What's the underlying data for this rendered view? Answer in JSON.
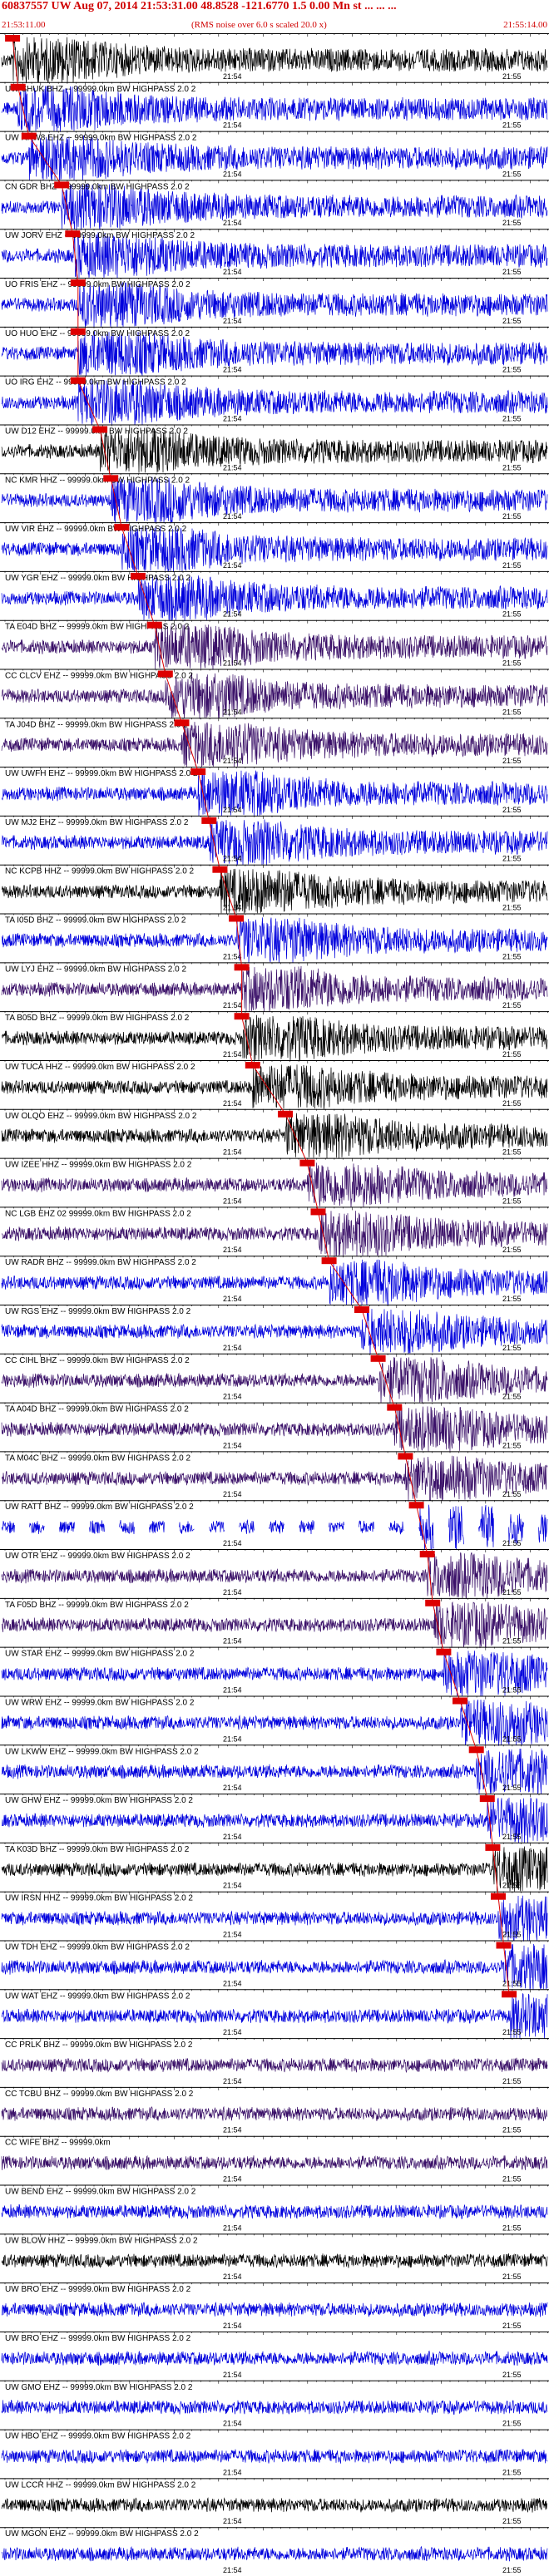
{
  "header": {
    "title": "60837557 UW Aug 07, 2014 21:53:31.00   48.8528 -121.6770   1.5 0.00 Mn st ... ... ...",
    "start_time": "21:53:11.00",
    "end_time": "21:55:14.00",
    "scale_note": "(RMS noise over 6.0 s scaled 20.0 x)"
  },
  "chart_data": {
    "type": "seismogram-record-section",
    "time_start": "21:53:11.00",
    "time_end": "21:55:14.00",
    "minute_labels": [
      "21:54",
      "21:55"
    ],
    "colors": {
      "black": "#000000",
      "blue": "#0000dd",
      "purple": "#3a1068",
      "pick": "#dd0000",
      "title": "#d00000"
    },
    "traces": [
      {
        "label": "",
        "color": "black",
        "pick": 0.02
      },
      {
        "label": "UW SHUK BHZ -- 99999.0km BW  HIGHPASS  2.0  2",
        "color": "blue",
        "pick": 0.03
      },
      {
        "label": "UW RPW8 EHZ -- 99999.0km BW  HIGHPASS  2.0  2",
        "color": "blue",
        "pick": 0.05
      },
      {
        "label": "CN GDR BHZ -- 99999.0km BW  HIGHPASS  2.0  2",
        "color": "blue",
        "pick": 0.11
      },
      {
        "label": "UW JORV EHZ -- 99999.0km BW  HIGHPASS  2.0  2",
        "color": "blue",
        "pick": 0.13
      },
      {
        "label": "UO FRIS EHZ -- 99999.0km BW  HIGHPASS  2.0  2",
        "color": "blue",
        "pick": 0.14
      },
      {
        "label": "UO HUO EHZ -- 99999.0km BW  HIGHPASS  2.0  2",
        "color": "blue",
        "pick": 0.14
      },
      {
        "label": "UO IRG EHZ -- 99999.0km BW  HIGHPASS  2.0  2",
        "color": "blue",
        "pick": 0.14
      },
      {
        "label": "UW D12 EHZ -- 99999.0km BW  HIGHPASS  2.0  2",
        "color": "black",
        "pick": 0.18
      },
      {
        "label": "NC KMR HHZ -- 99999.0km BW  HIGHPASS  2.0  2",
        "color": "blue",
        "pick": 0.2
      },
      {
        "label": "UW VIR EHZ -- 99999.0km BW  HIGHPASS  2.0  2",
        "color": "blue",
        "pick": 0.22
      },
      {
        "label": "UW YGR EHZ -- 99999.0km BW  HIGHPASS  2.0  2",
        "color": "blue",
        "pick": 0.25
      },
      {
        "label": "TA E04D BHZ -- 99999.0km BW  HIGHPASS  2.0  2",
        "color": "purple",
        "pick": 0.28
      },
      {
        "label": "CC CLCV EHZ -- 99999.0km BW  HIGHPASS  2.0  2",
        "color": "purple",
        "pick": 0.3
      },
      {
        "label": "TA J04D BHZ -- 99999.0km BW  HIGHPASS  2.0  2",
        "color": "purple",
        "pick": 0.33
      },
      {
        "label": "UW UWFH EHZ -- 99999.0km BW  HIGHPASS  2.0  2",
        "color": "blue",
        "pick": 0.36
      },
      {
        "label": "UW MJ2 EHZ -- 99999.0km BW  HIGHPASS  2.0  2",
        "color": "blue",
        "pick": 0.38
      },
      {
        "label": "NC KCPB HHZ -- 99999.0km BW  HIGHPASS  2.0  2",
        "color": "black",
        "pick": 0.4
      },
      {
        "label": "TA I05D BHZ -- 99999.0km BW  HIGHPASS  2.0  2",
        "color": "blue",
        "pick": 0.43
      },
      {
        "label": "UW LYJ EHZ -- 99999.0km BW  HIGHPASS  2.0  2",
        "color": "purple",
        "pick": 0.44
      },
      {
        "label": "TA B05D BHZ -- 99999.0km BW  HIGHPASS  2.0  2",
        "color": "black",
        "pick": 0.44
      },
      {
        "label": "UW TUCA HHZ -- 99999.0km BW  HIGHPASS  2.0  2",
        "color": "black",
        "pick": 0.46
      },
      {
        "label": "UW OLQO EHZ -- 99999.0km BW  HIGHPASS  2.0  2",
        "color": "black",
        "pick": 0.52
      },
      {
        "label": "UW IZEE HHZ -- 99999.0km BW  HIGHPASS  2.0  2",
        "color": "purple",
        "pick": 0.56
      },
      {
        "label": "NC LGB EHZ 02 99999.0km BW  HIGHPASS  2.0  2",
        "color": "purple",
        "pick": 0.58
      },
      {
        "label": "UW RADR BHZ -- 99999.0km BW  HIGHPASS  2.0  2",
        "color": "blue",
        "pick": 0.6
      },
      {
        "label": "UW RGS EHZ -- 99999.0km BW  HIGHPASS  2.0  2",
        "color": "blue",
        "pick": 0.66
      },
      {
        "label": "CC CIHL BHZ -- 99999.0km BW  HIGHPASS  2.0  2",
        "color": "purple",
        "pick": 0.69
      },
      {
        "label": "TA A04D BHZ -- 99999.0km BW  HIGHPASS  2.0  2",
        "color": "purple",
        "pick": 0.72
      },
      {
        "label": "TA M04C BHZ -- 99999.0km BW  HIGHPASS  2.0  2",
        "color": "purple",
        "pick": 0.74
      },
      {
        "label": "UW RATT BHZ -- 99999.0km BW  HIGHPASS  2.0  2",
        "color": "blue",
        "pick": 0.76,
        "gappy": true
      },
      {
        "label": "UW OTR EHZ -- 99999.0km BW  HIGHPASS  2.0  2",
        "color": "purple",
        "pick": 0.78
      },
      {
        "label": "TA F05D BHZ -- 99999.0km BW  HIGHPASS  2.0  2",
        "color": "purple",
        "pick": 0.79
      },
      {
        "label": "UW STAR EHZ -- 99999.0km BW  HIGHPASS  2.0  2",
        "color": "blue",
        "pick": 0.81
      },
      {
        "label": "UW WRW EHZ -- 99999.0km BW  HIGHPASS  2.0  2",
        "color": "blue",
        "pick": 0.84
      },
      {
        "label": "UW LKWW EHZ -- 99999.0km BW  HIGHPASS  2.0  2",
        "color": "blue",
        "pick": 0.87
      },
      {
        "label": "UW GHW EHZ -- 99999.0km BW  HIGHPASS  2.0  2",
        "color": "blue",
        "pick": 0.89
      },
      {
        "label": "TA K03D BHZ -- 99999.0km BW  HIGHPASS  2.0  2",
        "color": "black",
        "pick": 0.9
      },
      {
        "label": "UW IRSN HHZ -- 99999.0km BW  HIGHPASS  2.0  2",
        "color": "blue",
        "pick": 0.91
      },
      {
        "label": "UW TDH EHZ -- 99999.0km BW  HIGHPASS  2.0  2",
        "color": "blue",
        "pick": 0.92
      },
      {
        "label": "UW WAT EHZ -- 99999.0km BW  HIGHPASS  2.0  2",
        "color": "blue",
        "pick": 0.93
      },
      {
        "label": "CC PRLK BHZ -- 99999.0km BW  HIGHPASS  2.0  2",
        "color": "purple",
        "pick": null
      },
      {
        "label": "CC TCBU BHZ -- 99999.0km BW  HIGHPASS  2.0  2",
        "color": "purple",
        "pick": null
      },
      {
        "label": "CC WIFE BHZ -- 99999.0km",
        "color": "purple",
        "pick": null
      },
      {
        "label": "UW BEND EHZ -- 99999.0km BW  HIGHPASS  2.0  2",
        "color": "blue",
        "pick": null
      },
      {
        "label": "UW BLOW HHZ -- 99999.0km BW  HIGHPASS  2.0  2",
        "color": "black",
        "pick": null
      },
      {
        "label": "UW BRO EHZ -- 99999.0km BW  HIGHPASS  2.0  2",
        "color": "blue",
        "pick": null
      },
      {
        "label": "UW BRO EHZ -- 99999.0km BW  HIGHPASS  2.0  2",
        "color": "blue",
        "pick": null
      },
      {
        "label": "UW GMO EHZ -- 99999.0km BW  HIGHPASS  2.0  2",
        "color": "blue",
        "pick": null
      },
      {
        "label": "UW HBO EHZ -- 99999.0km BW  HIGHPASS  2.0  2",
        "color": "blue",
        "pick": null
      },
      {
        "label": "UW LCCR HHZ -- 99999.0km BW  HIGHPASS  2.0  2",
        "color": "black",
        "pick": null
      },
      {
        "label": "UW MGON EHZ -- 99999.0km BW  HIGHPASS  2.0  2",
        "color": "blue",
        "pick": null
      }
    ]
  }
}
